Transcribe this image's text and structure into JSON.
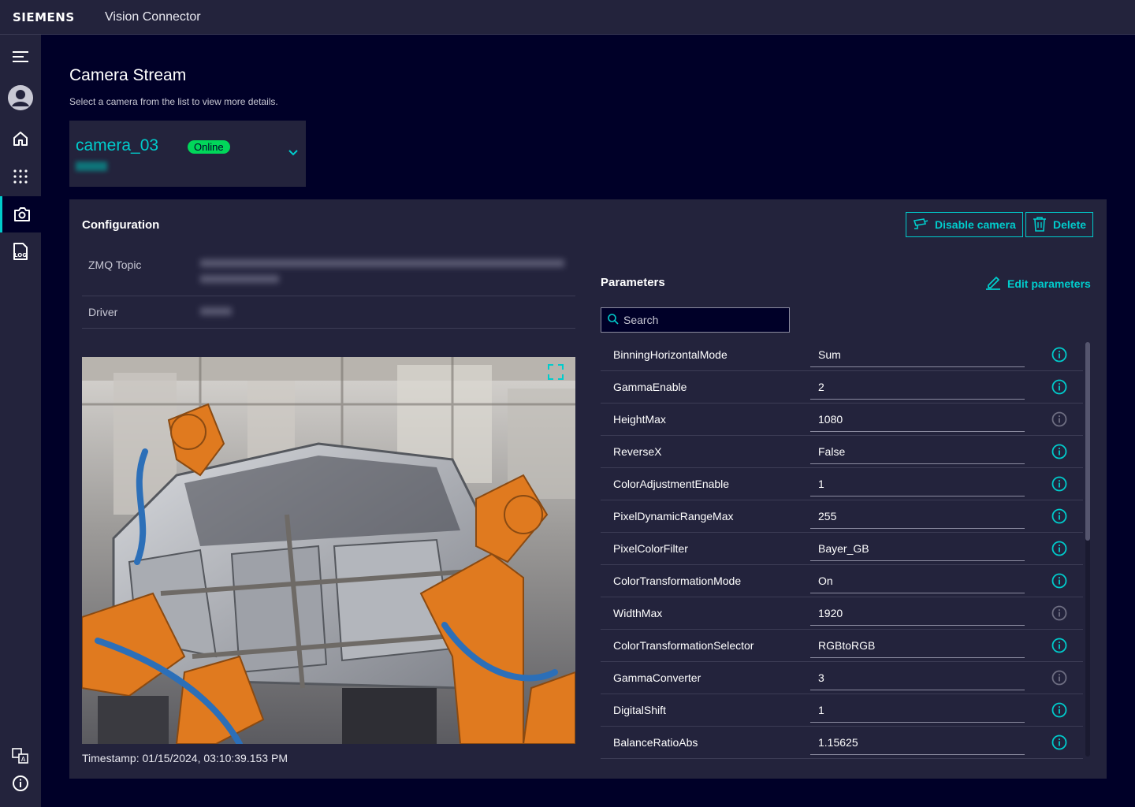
{
  "header": {
    "brand": "SIEMENS",
    "app_title": "Vision Connector"
  },
  "page": {
    "title": "Camera Stream",
    "subtitle": "Select a camera from the list to view more details."
  },
  "camera": {
    "name": "camera_03",
    "status": "Online"
  },
  "configuration": {
    "title": "Configuration",
    "disable_label": "Disable camera",
    "delete_label": "Delete",
    "fields": [
      {
        "label": "ZMQ Topic"
      },
      {
        "label": "Driver"
      }
    ],
    "timestamp": "Timestamp: 01/15/2024, 03:10:39.153 PM"
  },
  "parameters": {
    "title": "Parameters",
    "edit_label": "Edit parameters",
    "search_placeholder": "Search",
    "rows": [
      {
        "name": "BinningHorizontalMode",
        "value": "Sum",
        "info_active": true
      },
      {
        "name": "GammaEnable",
        "value": "2",
        "info_active": true
      },
      {
        "name": "HeightMax",
        "value": "1080",
        "info_active": false
      },
      {
        "name": "ReverseX",
        "value": "False",
        "info_active": true
      },
      {
        "name": "ColorAdjustmentEnable",
        "value": "1",
        "info_active": true
      },
      {
        "name": "PixelDynamicRangeMax",
        "value": "255",
        "info_active": true
      },
      {
        "name": "PixelColorFilter",
        "value": "Bayer_GB",
        "info_active": true
      },
      {
        "name": "ColorTransformationMode",
        "value": "On",
        "info_active": true
      },
      {
        "name": "WidthMax",
        "value": "1920",
        "info_active": false
      },
      {
        "name": "ColorTransformationSelector",
        "value": "RGBtoRGB",
        "info_active": true
      },
      {
        "name": "GammaConverter",
        "value": "3",
        "info_active": false
      },
      {
        "name": "DigitalShift",
        "value": "1",
        "info_active": true
      },
      {
        "name": "BalanceRatioAbs",
        "value": "1.15625",
        "info_active": true
      }
    ]
  },
  "colors": {
    "accent": "#00cccc",
    "online": "#01d65a",
    "background": "#000028",
    "surface": "#23233c"
  }
}
